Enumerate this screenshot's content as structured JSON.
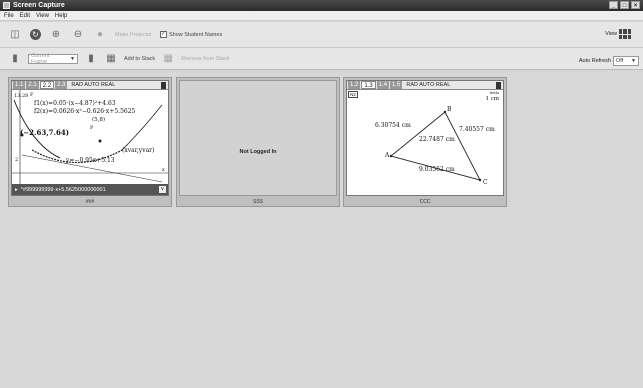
{
  "window": {
    "title": "Screen Capture",
    "controls": [
      "_",
      "□",
      "×"
    ]
  },
  "menu": [
    "File",
    "Edit",
    "View",
    "Help"
  ],
  "toolbar1": {
    "send_label": "Make Projector",
    "show_names_label": "Show Student Names",
    "show_names_checked": "✓",
    "view_label": "View"
  },
  "toolbar2": {
    "frame_select": "Current Frame",
    "add_to_stack_label": "Add to Stack",
    "remove_label": "Remove from Stack",
    "auto_refresh_label": "Auto Refresh",
    "auto_refresh_value": "Off"
  },
  "panels": [
    {
      "tabs": [
        "1.1",
        "2.1",
        "2.2",
        "2.3"
      ],
      "active_tab": "2.2",
      "mode": "RAD AUTO REAL",
      "caption": "###",
      "graph": {
        "y_top": "13.28",
        "f1": "f1(x)=0.05·(x−4.87)²+4.63",
        "f2": "f2(x)=0.0626·x²−0.626·x+5.5625",
        "point_label": "(−2.63,7.64)",
        "p_top": "(5,8)",
        "p_letter": "P",
        "f_letter": "F",
        "line_eq": "y=−0.95x+5.13",
        "var_label": "(xvar,yvar)",
        "y_tick": "2",
        "x_tick": "x"
      },
      "entry": "*#999999999·x+5.5625000000001"
    },
    {
      "message": "Not Logged In",
      "caption": "SSS"
    },
    {
      "tabs": [
        "1.2",
        "1.3",
        "1.4",
        "1.5"
      ],
      "active_tab": "1.3",
      "mode": "RAD AUTO REAL",
      "caption": "CCC",
      "geometry": {
        "scale_small": "ttetts",
        "scale": "1 cm",
        "corner_tag": "N2",
        "side_ab": "6.30754 cm",
        "side_bc": "7.40557 cm",
        "side_ac": "9.03562 cm",
        "perimeter": "22.7487 cm",
        "a": "A",
        "b": "B",
        "c": "C"
      }
    }
  ]
}
